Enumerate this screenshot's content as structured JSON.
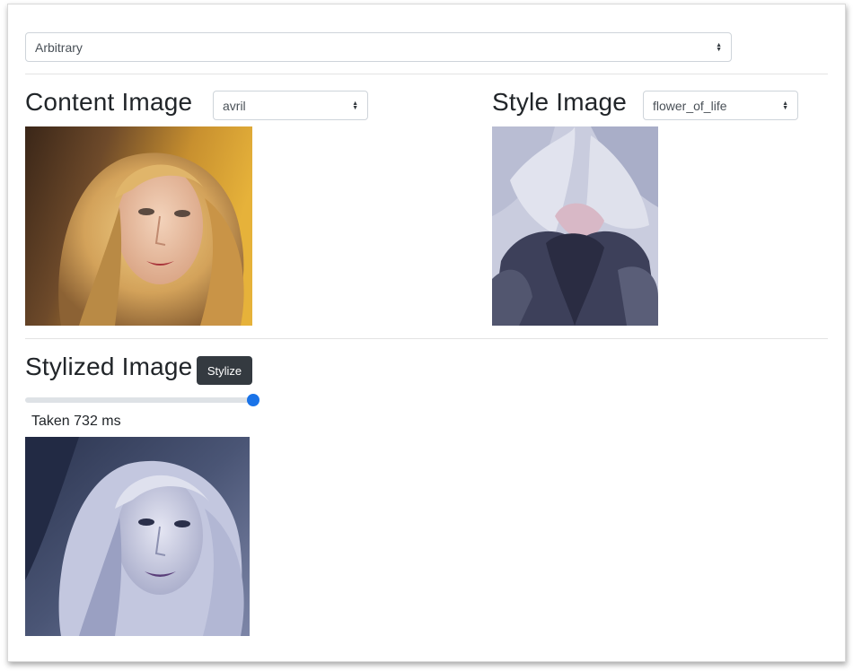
{
  "model_select": {
    "value": "Arbitrary"
  },
  "content": {
    "heading": "Content Image",
    "select_value": "avril"
  },
  "style": {
    "heading": "Style Image",
    "select_value": "flower_of_life"
  },
  "stylized": {
    "heading": "Stylized Image",
    "button_label": "Stylize",
    "strength": 1.0,
    "status": "Taken 732 ms"
  },
  "colors": {
    "accent": "#1a73e8",
    "button": "#343a40"
  },
  "icons": {
    "select_caret": "sort-caret-icon"
  }
}
